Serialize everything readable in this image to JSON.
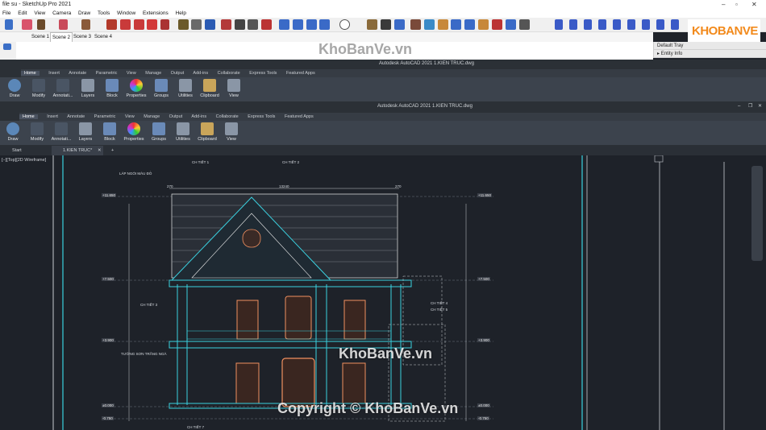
{
  "sketchup": {
    "window_title": "file su - SketchUp Pro 2021",
    "menu": [
      "File",
      "Edit",
      "View",
      "Camera",
      "Draw",
      "Tools",
      "Window",
      "Extensions",
      "Help"
    ],
    "scenes": [
      "Scene 1",
      "Scene 2",
      "Scene 3",
      "Scene 4"
    ],
    "active_scene": "Scene 2",
    "tray_title": "Default Tray",
    "tray_item": "Entity Info"
  },
  "acad_back": {
    "title": "Autodesk AutoCAD 2021   1.KIEN TRUC.dwg",
    "ribbon_tabs": [
      "Home",
      "Insert",
      "Annotate",
      "Parametric",
      "View",
      "Manage",
      "Output",
      "Add-ins",
      "Collaborate",
      "Express Tools",
      "Featured Apps"
    ],
    "ribbon_buttons": [
      "Draw",
      "Modify",
      "Annotati...",
      "Layers",
      "Block",
      "Properties",
      "Groups",
      "Utilities",
      "Clipboard",
      "View"
    ]
  },
  "acad_front": {
    "title": "Autodesk AutoCAD 2021   1.KIEN TRUC.dwg",
    "ribbon_tabs": [
      "Home",
      "Insert",
      "Annotate",
      "Parametric",
      "View",
      "Manage",
      "Output",
      "Add-ins",
      "Collaborate",
      "Express Tools",
      "Featured Apps"
    ],
    "ribbon_buttons": [
      "Draw",
      "Modify",
      "Annotati...",
      "Layers",
      "Block",
      "Properties",
      "Groups",
      "Utilities",
      "Clipboard",
      "View"
    ],
    "doc_tabs": [
      "Start",
      "1.KIEN TRUC*"
    ],
    "viewport_label": "[−][Top][2D Wireframe]"
  },
  "drawing": {
    "labels": {
      "lap_ngoi": "LÁP NGÓI MÀU ĐỎ",
      "chi_tiet_1": "CH TIẾT 1",
      "chi_tiet_2": "CH TIẾT 2",
      "chi_tiet_3": "CH TIẾT 3",
      "chi_tiet_4": "CH TIẾT 4",
      "chi_tiet_5": "CH TIẾT 5",
      "chi_tiet_7": "CH TIẾT 7",
      "tuong_son": "TƯỜNG SƠN TRẮNG NGÀ",
      "dim_top": "13240",
      "dim_left": "270",
      "dim_right": "270"
    },
    "levels_left": [
      "+11.650",
      "+7.500",
      "+3.900",
      "±0.000",
      "-0.750"
    ],
    "levels_right": [
      "+11.650",
      "+7.500",
      "+3.900",
      "±0.000",
      "-0.750"
    ]
  },
  "watermarks": {
    "logo": "KHOBANVE",
    "top": "KhoBanVe.vn",
    "mid": "KhoBanVe.vn",
    "bottom": "Copyright © KhoBanVe.vn"
  }
}
